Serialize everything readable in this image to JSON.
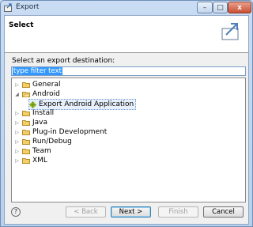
{
  "window": {
    "title": "Export"
  },
  "header": {
    "title": "Select"
  },
  "destination": {
    "label": "Select an export destination:",
    "filter_value": "type filter text"
  },
  "tree": {
    "items": [
      {
        "label": "General"
      },
      {
        "label": "Android"
      },
      {
        "label": "Export Android Application"
      },
      {
        "label": "Install"
      },
      {
        "label": "Java"
      },
      {
        "label": "Plug-in Development"
      },
      {
        "label": "Run/Debug"
      },
      {
        "label": "Team"
      },
      {
        "label": "XML"
      }
    ]
  },
  "buttons": {
    "help": "?",
    "back": "< Back",
    "next": "Next >",
    "finish": "Finish",
    "cancel": "Cancel"
  },
  "titlebar_buttons": {
    "minimize": "–",
    "maximize": "□",
    "close": "x"
  }
}
